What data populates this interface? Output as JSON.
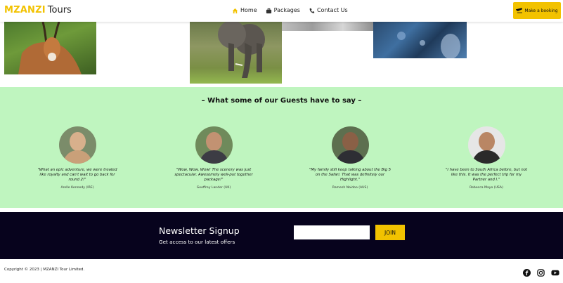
{
  "header": {
    "logo_brand": "MZANZI",
    "logo_sub": "Tours",
    "nav": [
      {
        "label": "Home",
        "icon": "home-icon"
      },
      {
        "label": "Packages",
        "icon": "briefcase-icon"
      },
      {
        "label": "Contact Us",
        "icon": "phone-icon"
      }
    ],
    "booking_label": "Make a booking",
    "accent": "#f2c200"
  },
  "testimonials": {
    "title": "– What some of our Guests have to say –",
    "background": "#bff5bf",
    "guests": [
      {
        "quote": "\"What an epic adventure, we were treated like royalty and can't wait to go back for round 2!\"",
        "author": "Arelle Kennedy (IRE)"
      },
      {
        "quote": "\"Wow, Wow, Wow! The scenery was just spectacular. Awesomely well-put together package!\"",
        "author": "Geoffrey Lander (UK)"
      },
      {
        "quote": "\"My family still keep talking about the Big 5 on the Safari. That was definitely our Highlight.\"",
        "author": "Ramesh Naidoo (AUS)"
      },
      {
        "quote": "\"I have been to South Africa before, but not like this. It was the perfect trip for my Partner and I.\"",
        "author": "Rebecca Mayo (USA)"
      }
    ]
  },
  "newsletter": {
    "title": "Newsletter Signup",
    "subtitle": "Get access to our latest offers",
    "input_value": "",
    "button_label": "JOIN",
    "background": "#07031d"
  },
  "footer": {
    "copyright": "Copyright © 2023 | MZANZI Tour Limited.",
    "social": [
      "facebook-icon",
      "instagram-icon",
      "youtube-icon"
    ]
  }
}
